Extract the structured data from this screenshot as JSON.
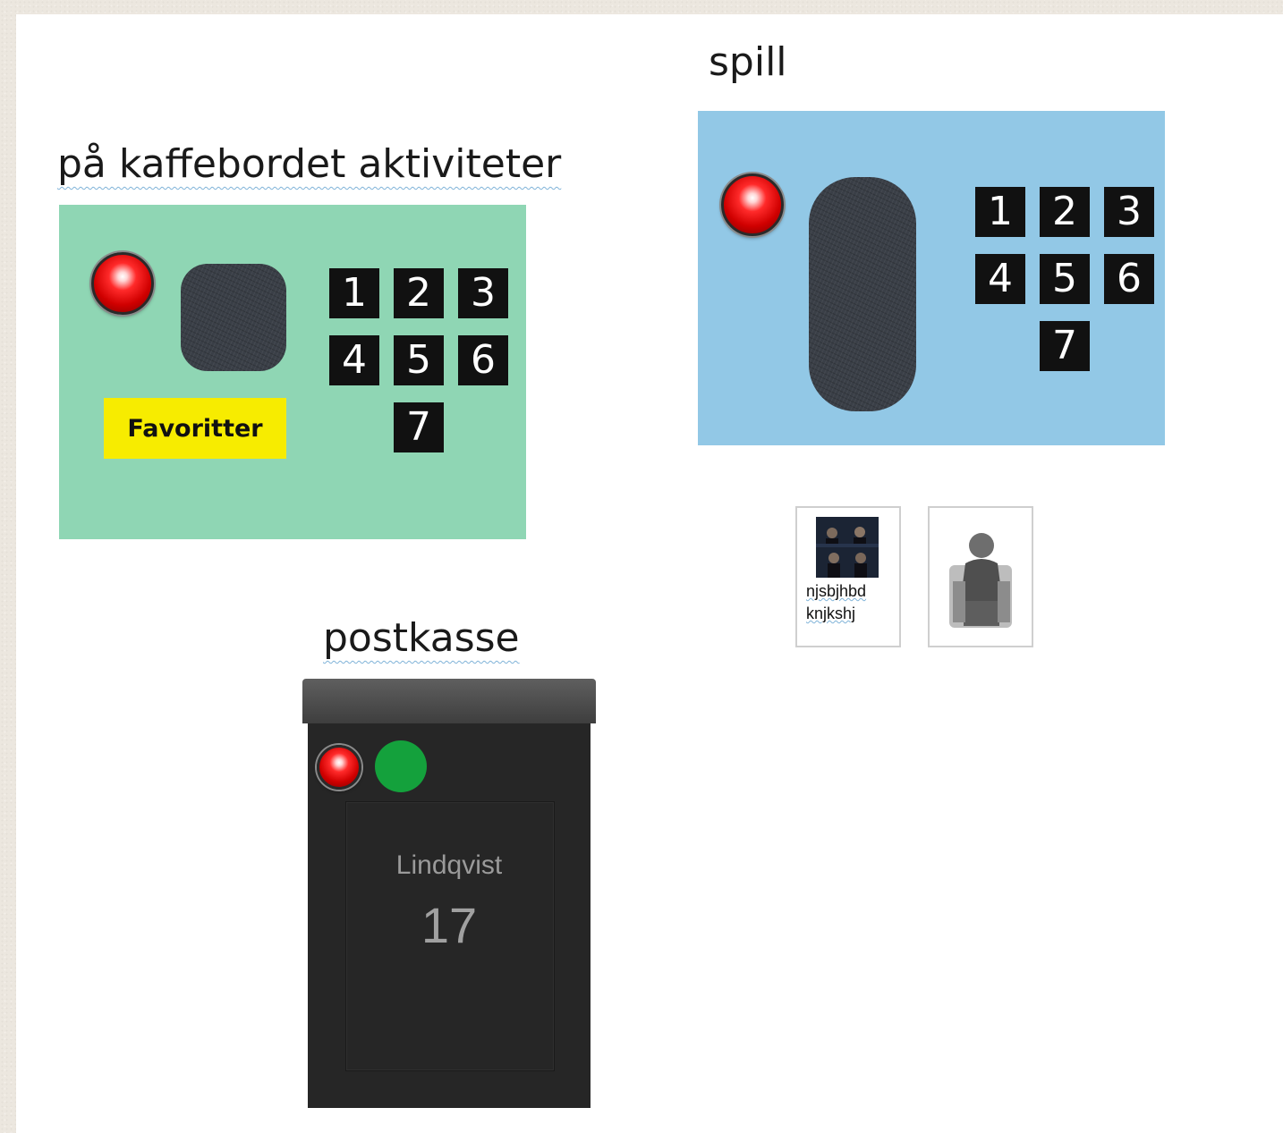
{
  "sections": {
    "coffee_table": {
      "title": "på kaffebordet aktiviteter",
      "favorites_label": "Favoritter",
      "keys": [
        "1",
        "2",
        "3",
        "4",
        "5",
        "6",
        "7"
      ]
    },
    "games": {
      "title": "spill",
      "keys": [
        "1",
        "2",
        "3",
        "4",
        "5",
        "6",
        "7"
      ],
      "thumbnails": [
        {
          "caption_line1": "njsbjhbd",
          "caption_line2": "knjkshj"
        },
        {
          "caption_line1": "",
          "caption_line2": ""
        }
      ]
    },
    "mailbox": {
      "title": "postkasse",
      "name": "Lindqvist",
      "number": "17"
    }
  },
  "colors": {
    "coffee_panel": "#8fd6b4",
    "games_panel": "#92c8e6",
    "favorites_bg": "#f7ec00",
    "red_button": "#e00000",
    "green_button": "#14a13c",
    "key_bg": "#111111"
  },
  "icons": {
    "red_button": "red-round-button-icon",
    "green_button": "green-round-button-icon",
    "touch_pad": "touch-pad-icon"
  }
}
